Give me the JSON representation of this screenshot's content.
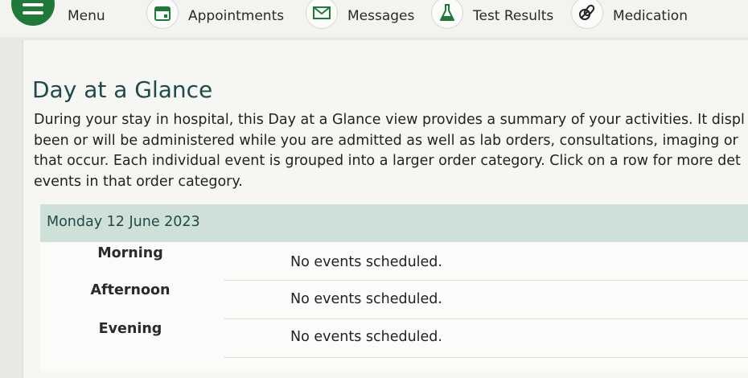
{
  "nav": {
    "menu_label": "Menu",
    "items": [
      {
        "label": "Appointments",
        "icon": "calendar-icon"
      },
      {
        "label": "Messages",
        "icon": "envelope-icon"
      },
      {
        "label": "Test Results",
        "icon": "flask-icon"
      },
      {
        "label": "Medication",
        "icon": "pills-icon"
      }
    ]
  },
  "page": {
    "title": "Day at a Glance",
    "intro_lines": [
      "During your stay in hospital, this Day at a Glance view provides a summary of your activities. It displ",
      "been or will be administered while you are admitted as well as lab orders, consultations, imaging or",
      "that occur. Each individual event is grouped into a larger order category. Click on a row for more det",
      "events in that order category."
    ]
  },
  "schedule": {
    "date": "Monday 12 June 2023",
    "rows": [
      {
        "period": "Morning",
        "status": "No events scheduled."
      },
      {
        "period": "Afternoon",
        "status": "No events scheduled."
      },
      {
        "period": "Evening",
        "status": "No events scheduled."
      }
    ]
  },
  "colors": {
    "brand_green": "#1f7a3a",
    "title_teal": "#1e4a4a",
    "date_header_bg": "#cfe0d8"
  }
}
